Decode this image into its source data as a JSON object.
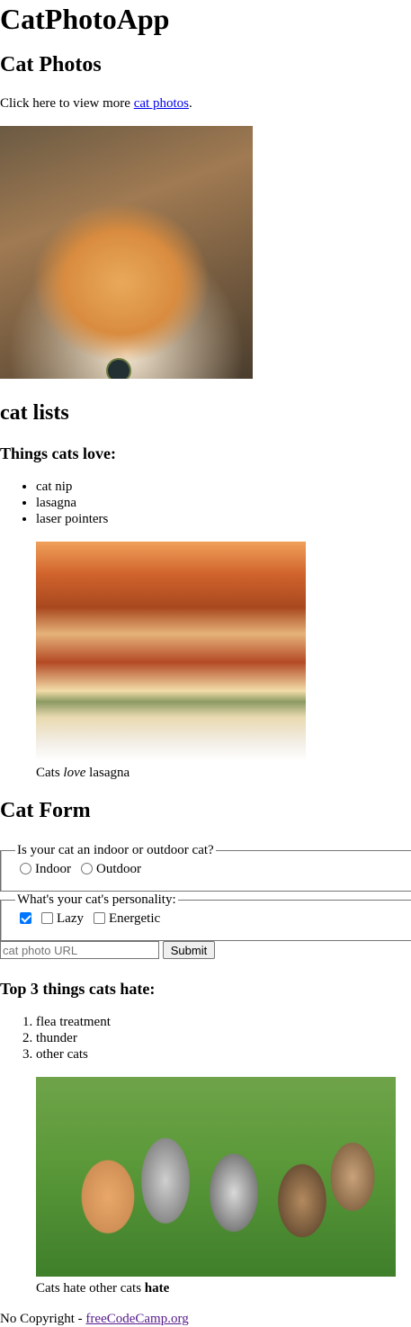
{
  "header": {
    "title": "CatPhotoApp"
  },
  "cat_photos": {
    "heading": "Cat Photos",
    "text_before": "Click here to view more ",
    "link_text": "cat photos",
    "text_after": "."
  },
  "cat_lists": {
    "heading": "cat lists",
    "love": {
      "heading": "Things cats love:",
      "items": [
        "cat nip",
        "lasagna",
        "laser pointers"
      ],
      "caption_prefix": "Cats ",
      "caption_em": "love",
      "caption_suffix": " lasagna"
    },
    "hate": {
      "heading": "Top 3 things cats hate:",
      "items": [
        "flea treatment",
        "thunder",
        "other cats"
      ],
      "caption_prefix": "Cats hate other cats ",
      "caption_strong": "hate"
    }
  },
  "form": {
    "heading": "Cat Form",
    "location_legend": "Is your cat an indoor or outdoor cat?",
    "location_options": [
      "Indoor",
      "Outdoor"
    ],
    "personality_legend": "What's your cat's personality:",
    "personality_options": [
      "Lazy",
      "Energetic"
    ],
    "url_placeholder": "cat photo URL",
    "submit_label": "Submit"
  },
  "footer": {
    "text": "No Copyright - ",
    "link_text": "freeCodeCamp.org"
  }
}
